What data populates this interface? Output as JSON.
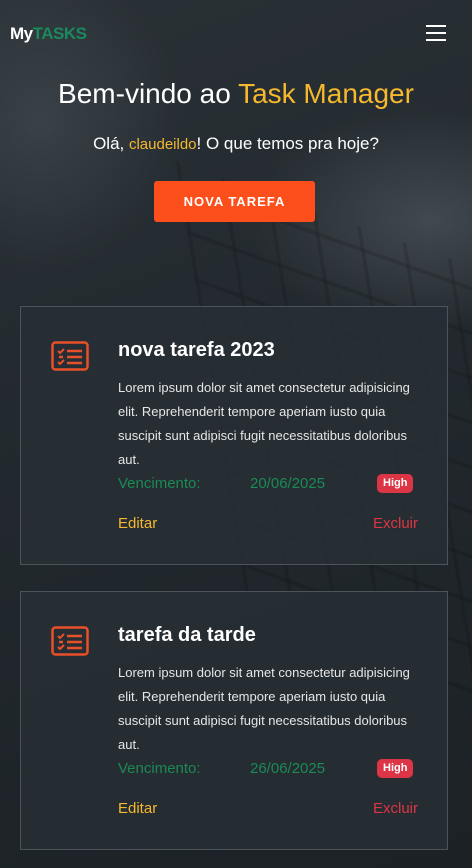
{
  "brand": {
    "part1": "My",
    "part2": "TASKS"
  },
  "hero": {
    "title_prefix": "Bem-vindo ao ",
    "title_accent": "Task Manager",
    "greeting_prefix": "Olá, ",
    "username": "claudeildo",
    "greeting_suffix": "! O que temos pra hoje?"
  },
  "new_task_button": "NOVA TAREFA",
  "tasks": [
    {
      "title": "nova tarefa 2023",
      "description": "Lorem ipsum dolor sit amet consectetur adipisicing elit. Reprehenderit tempore aperiam iusto quia suscipit sunt adipisci fugit necessitatibus doloribus aut.",
      "due_label": "Vencimento:",
      "due_date": "20/06/2025",
      "priority": "High",
      "edit_label": "Editar",
      "delete_label": "Excluir"
    },
    {
      "title": "tarefa da tarde",
      "description": "Lorem ipsum dolor sit amet consectetur adipisicing elit. Reprehenderit tempore aperiam iusto quia suscipit sunt adipisci fugit necessitatibus doloribus aut.",
      "due_label": "Vencimento:",
      "due_date": "26/06/2025",
      "priority": "High",
      "edit_label": "Editar",
      "delete_label": "Excluir"
    }
  ],
  "colors": {
    "accent": "#f5b82e",
    "button": "#fd4f1c",
    "due": "#1b8a55",
    "danger": "#dc3545",
    "icon": "#e8502a"
  },
  "icons": {
    "menu": "hamburger-icon",
    "task": "task-list-icon"
  }
}
